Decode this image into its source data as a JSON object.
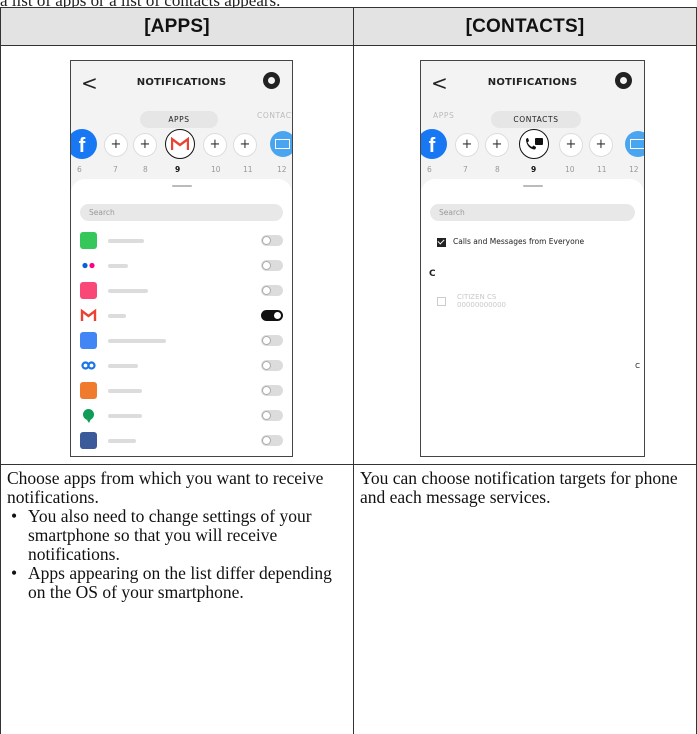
{
  "top_text": "a list of apps or a list of contacts appears.",
  "headers": [
    "[APPS]",
    "[CONTACTS]"
  ],
  "apps_screen": {
    "title": "NOTIFICATIONS",
    "back_glyph": "<",
    "tabs": [
      "APPS",
      "CONTACTS"
    ],
    "slot_numbers": [
      "6",
      "7",
      "8",
      "9",
      "10",
      "11",
      "12"
    ],
    "selected_slot": "9",
    "plus_glyph": "+",
    "search_placeholder": "Search",
    "apps": [
      {
        "icon": "facetime-icon",
        "color": "#35c759",
        "on": false
      },
      {
        "icon": "flickr-icon",
        "color": "#ffffff",
        "on": false
      },
      {
        "icon": "foursquare-icon",
        "color": "#f94877",
        "on": false
      },
      {
        "icon": "gmail-icon",
        "color": "#ffffff",
        "on": true
      },
      {
        "icon": "google-calendar-icon",
        "color": "#4285f4",
        "on": false
      },
      {
        "icon": "google-plus-icon",
        "color": "#ffffff",
        "on": false
      },
      {
        "icon": "hootsuite-icon",
        "color": "#f07a2e",
        "on": false
      },
      {
        "icon": "hangouts-icon",
        "color": "#0f9d58",
        "on": false
      },
      {
        "icon": "heytell-icon",
        "color": "#3a5a99",
        "on": false
      },
      {
        "icon": "instagram-icon",
        "color": "#d62976",
        "on": false
      },
      {
        "icon": "kakaotalk-icon",
        "color": "#f9e000",
        "on": false
      },
      {
        "icon": "kik-icon",
        "color": "#82bc23",
        "on": false
      }
    ]
  },
  "contacts_screen": {
    "title": "NOTIFICATIONS",
    "back_glyph": "<",
    "tabs": [
      "APPS",
      "CONTACTS"
    ],
    "slot_numbers": [
      "6",
      "7",
      "8",
      "9",
      "10",
      "11",
      "12"
    ],
    "selected_slot": "9",
    "plus_glyph": "+",
    "search_placeholder": "Search",
    "everyone_label": "Calls and Messages from Everyone",
    "section_letter": "C",
    "contact_name": "CITIZEN CS",
    "contact_number": "00000000000",
    "index_letter": "C"
  },
  "descriptions": {
    "apps_intro": "Choose apps from which you want to receive notifications.",
    "apps_bullets": [
      "You also need to change settings of your smartphone so that you will receive notifications.",
      "Apps appearing on the list differ depending on the OS of your smartphone."
    ],
    "contacts_text": "You can choose notification targets for phone and each message services."
  },
  "colors": {
    "header_bg": "#e3e3e3",
    "facebook_blue": "#1877f2",
    "mail_blue": "#49a5f0",
    "toggle_on": "#111111"
  }
}
